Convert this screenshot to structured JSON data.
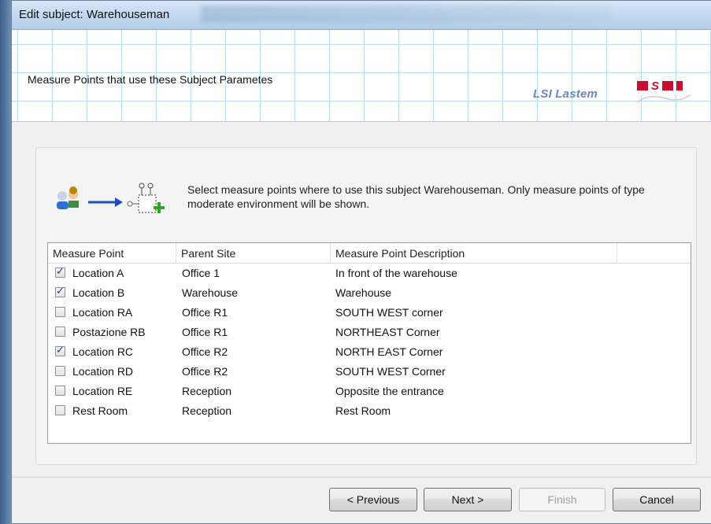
{
  "window": {
    "title": "Edit subject: Warehouseman"
  },
  "header": {
    "heading": "Measure Points that use these Subject Parametes",
    "brand_text": "LSI Lastem"
  },
  "instruction": "Select measure points where to use this subject Warehouseman. Only measure points of type moderate environment will be shown.",
  "table": {
    "columns": [
      "Measure Point",
      "Parent Site",
      "Measure Point Description",
      ""
    ],
    "rows": [
      {
        "checked": true,
        "measure_point": "Location A",
        "parent_site": "Office 1",
        "description": "In front of the warehouse"
      },
      {
        "checked": true,
        "measure_point": "Location B",
        "parent_site": "Warehouse",
        "description": "Warehouse"
      },
      {
        "checked": false,
        "measure_point": "Location RA",
        "parent_site": "Office R1",
        "description": "SOUTH WEST corner"
      },
      {
        "checked": false,
        "measure_point": "Postazione RB",
        "parent_site": "Office R1",
        "description": "NORTHEAST Corner"
      },
      {
        "checked": true,
        "measure_point": "Location RC",
        "parent_site": "Office R2",
        "description": "NORTH EAST Corner"
      },
      {
        "checked": false,
        "measure_point": "Location RD",
        "parent_site": "Office R2",
        "description": "SOUTH WEST Corner"
      },
      {
        "checked": false,
        "measure_point": "Location RE",
        "parent_site": "Reception",
        "description": "Opposite the entrance"
      },
      {
        "checked": false,
        "measure_point": "Rest Room",
        "parent_site": "Reception",
        "description": "Rest Room"
      }
    ]
  },
  "buttons": {
    "previous": "< Previous",
    "next": "Next >",
    "finish": "Finish",
    "cancel": "Cancel",
    "finish_enabled": false
  },
  "icons": {
    "illustration": [
      "users-icon",
      "arrow-right-icon",
      "measure-point-add-icon"
    ],
    "logo": "lsi-lastem-logo"
  },
  "colors": {
    "title_bar": "#c3d8ef",
    "grid_lines": "#bcdcf2",
    "brand_blue": "#6b89bd",
    "logo_red": "#c8102e",
    "checkmark": "#1f3e8a"
  }
}
